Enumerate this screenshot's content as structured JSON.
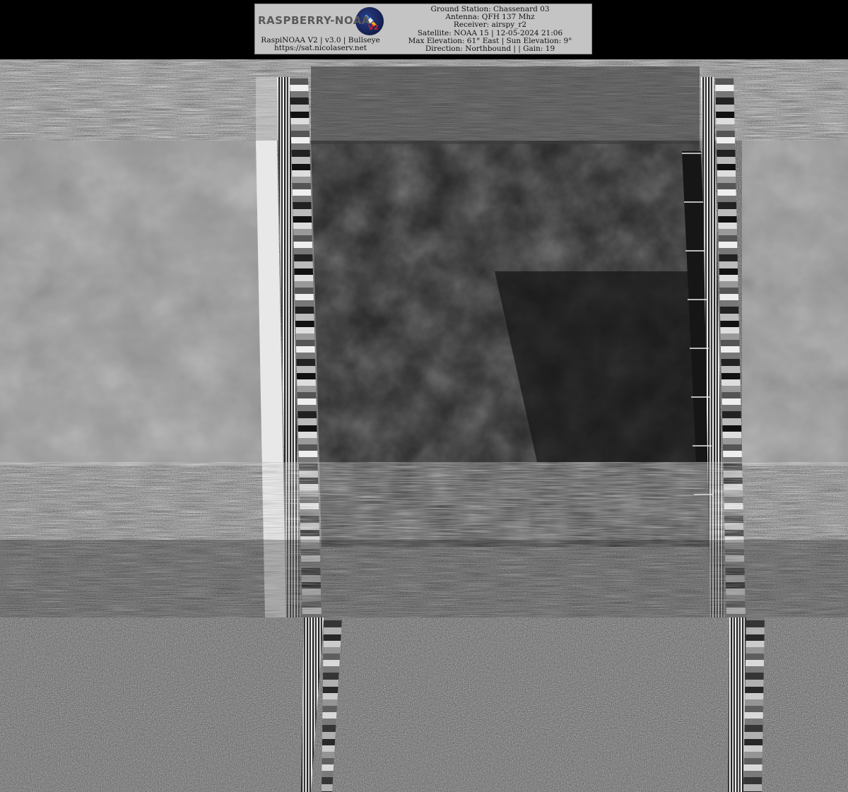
{
  "header": {
    "logo": {
      "text": "RASPBERRY-NOAA",
      "version": "V2"
    },
    "left_lines": [
      "RaspiNOAA V2 | v3.0 | Bullseye",
      "https://sat.nicolaserv.net"
    ],
    "right_lines": [
      "Ground Station: Chassenard 03",
      "Antenna: QFH 137 Mhz",
      "Receiver: airspy_r2",
      "Satellite: NOAA 15 | 12-05-2024 21:06",
      "Max Elevation: 61° East | Sun Elevation: 9°",
      "Direction: Northbound | | Gain: 19"
    ]
  },
  "image": {
    "description_icon": "satellite-apt-image",
    "colors": {
      "background": "#000000",
      "header_box": "#c4c4c4",
      "accent": "#d0202a"
    }
  }
}
